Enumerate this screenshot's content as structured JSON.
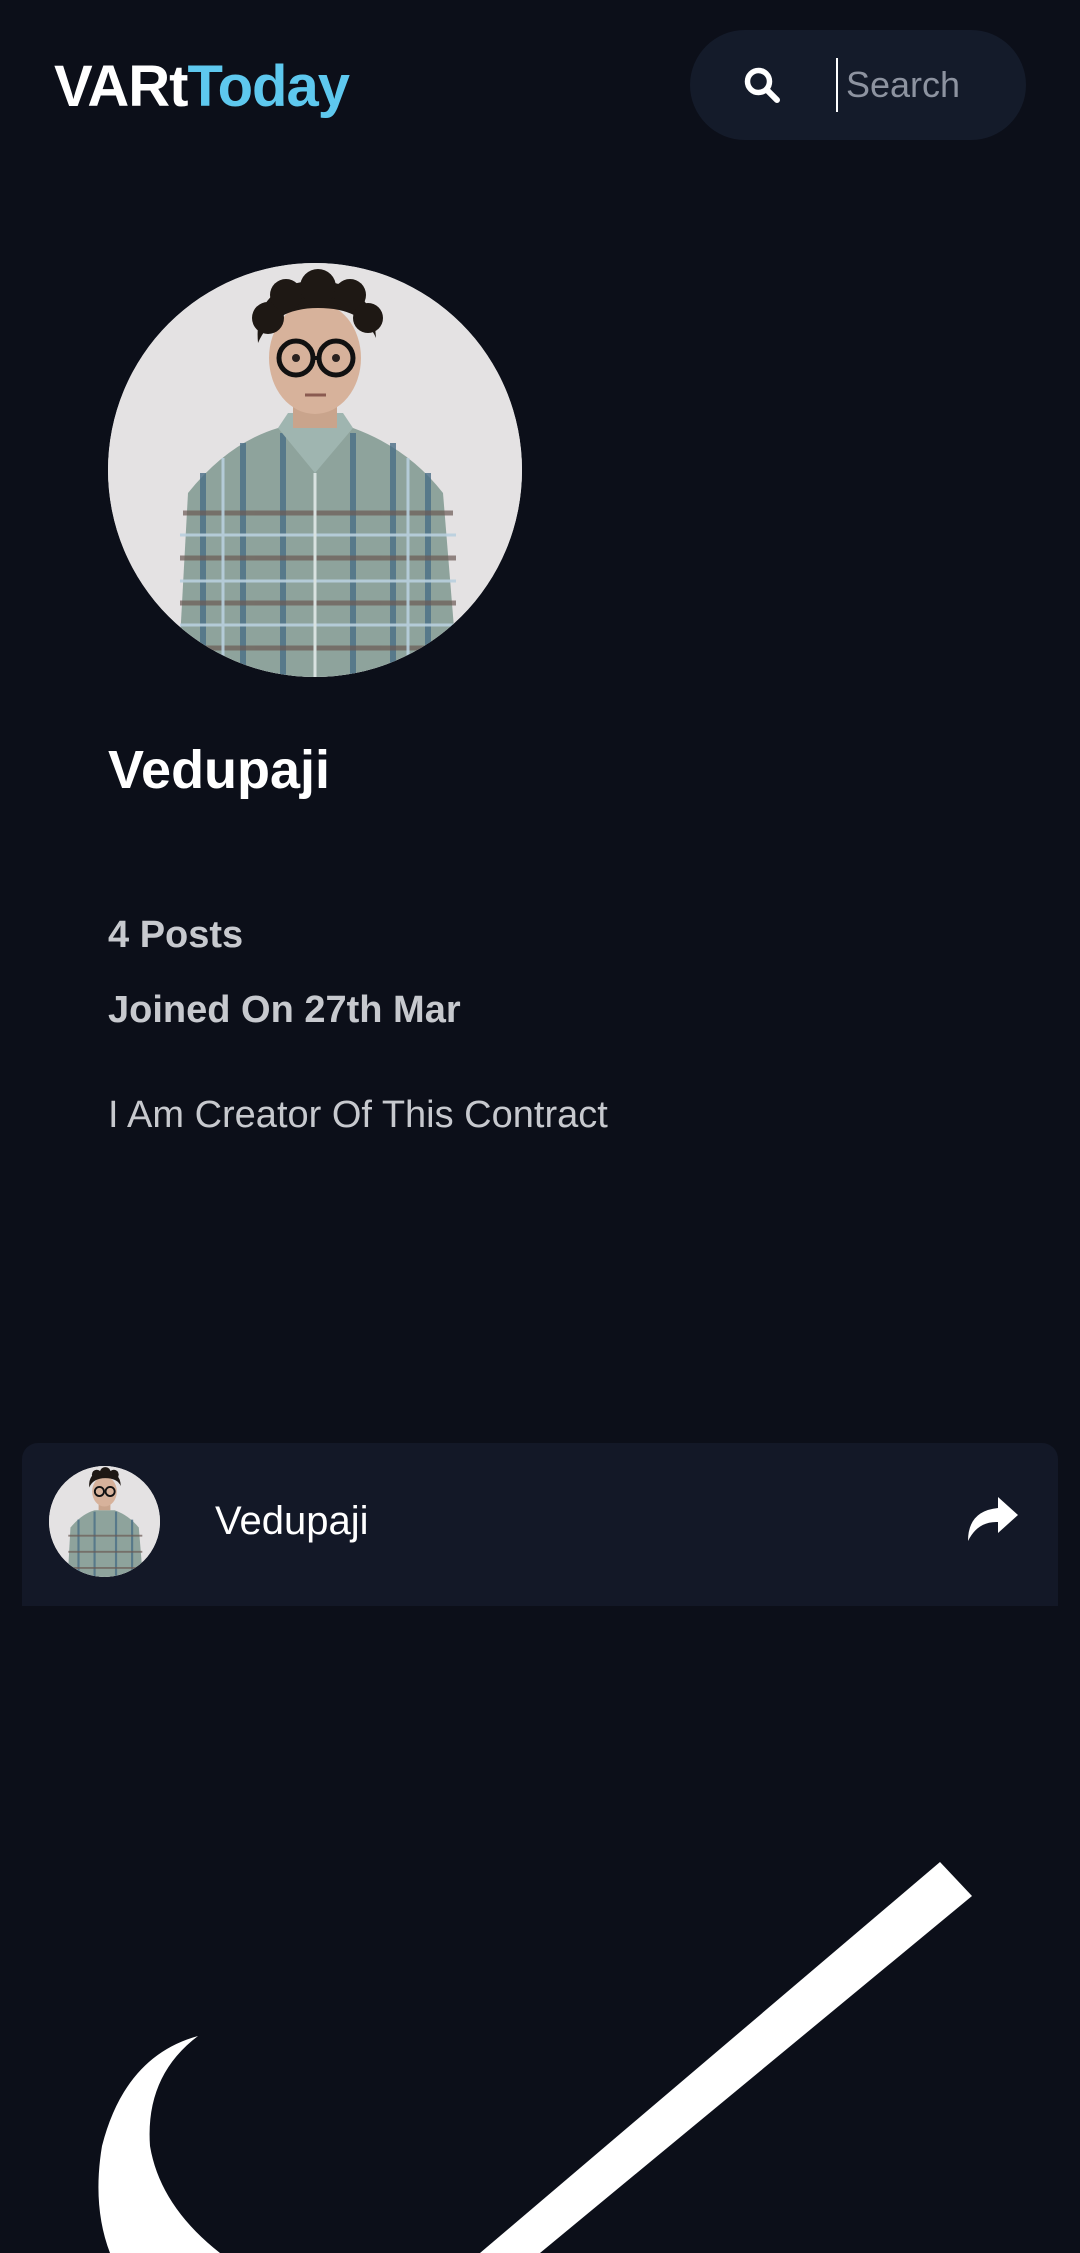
{
  "header": {
    "logo_part1": "VARt",
    "logo_part2": "Today",
    "search": {
      "placeholder": "Search",
      "icon": "search-icon"
    }
  },
  "profile": {
    "name": "Vedupaji",
    "posts": "4 Posts",
    "joined": "Joined On 27th Mar",
    "bio": "I Am Creator Of This Contract"
  },
  "post": {
    "author": "Vedupaji",
    "share_icon": "share-icon"
  },
  "colors": {
    "background": "#0c0f19",
    "card": "#131827",
    "accent": "#5ec8ee",
    "muted_text": "#c7c9ce"
  }
}
